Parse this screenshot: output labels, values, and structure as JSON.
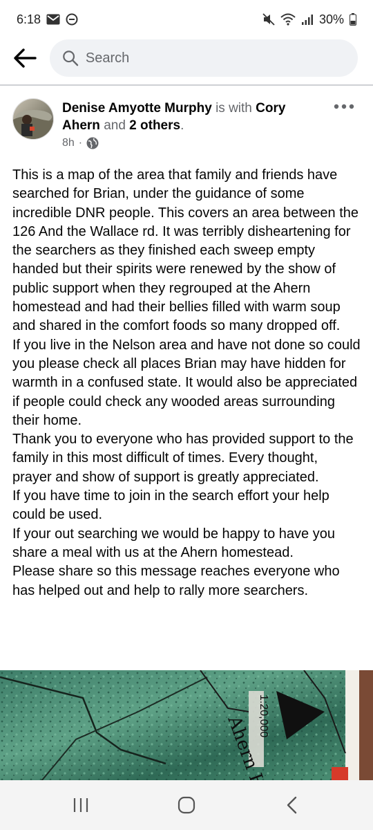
{
  "status_bar": {
    "time": "6:18",
    "battery": "30%"
  },
  "search": {
    "placeholder": "Search"
  },
  "post": {
    "author": "Denise Amyotte Murphy",
    "with_text": "is with",
    "tagged_person": "Cory Ahern",
    "and_text": "and",
    "others": "2 others",
    "end_period": ".",
    "time": "8h",
    "separator": "·",
    "body": [
      "This is a map of the area that family and friends have searched for Brian, under the guidance of some incredible DNR people. This covers an area between the 126 And the Wallace rd. It was terribly disheartening for the searchers as they finished each sweep empty handed but their spirits were renewed by the show of public support when they regrouped at the Ahern homestead and had their bellies filled with warm soup and shared in the comfort foods so many dropped off.",
      "If you live in the Nelson area and have not done so could you please check all places Brian may have hidden for warmth in a confused state. It would also be appreciated if people could check any wooded areas surrounding their home.",
      "Thank you to everyone who has provided support to the family in this most difficult of times. Every thought, prayer and show of support is greatly appreciated.",
      "If you have time to join in the search effort your help could be used.",
      "If your out searching we would be happy to have you share a meal with us at the Ahern homestead.",
      "Please share so this message reaches everyone who has helped out and help to rally more searchers."
    ],
    "map": {
      "scale_label": "1:20,000",
      "handwritten_label": "Ahern Home"
    }
  },
  "colors": {
    "secondary_text": "#65676b",
    "search_bg": "#f0f2f5",
    "nav_bg": "#f4f4f4"
  },
  "icons": [
    "mail-icon",
    "dnd-icon",
    "mute-icon",
    "wifi-icon",
    "signal-icon",
    "battery-icon",
    "back-arrow-icon",
    "search-icon",
    "globe-icon",
    "more-icon",
    "recent-apps-icon",
    "home-icon",
    "back-nav-icon"
  ]
}
